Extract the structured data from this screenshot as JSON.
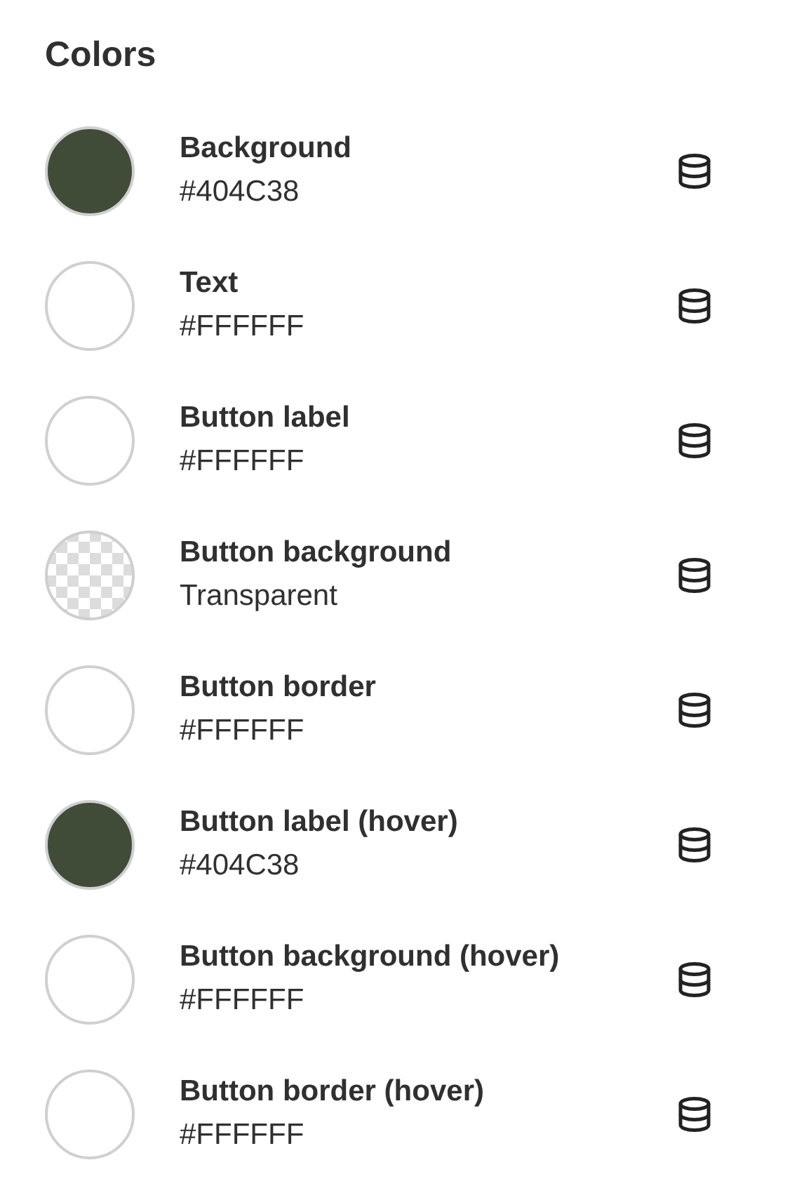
{
  "title": "Colors",
  "colors": [
    {
      "name": "Background",
      "value": "#404C38",
      "kind": "solid",
      "color": "#404c38"
    },
    {
      "name": "Text",
      "value": "#FFFFFF",
      "kind": "solid",
      "color": "#ffffff"
    },
    {
      "name": "Button label",
      "value": "#FFFFFF",
      "kind": "solid",
      "color": "#ffffff"
    },
    {
      "name": "Button background",
      "value": "Transparent",
      "kind": "transparent"
    },
    {
      "name": "Button border",
      "value": "#FFFFFF",
      "kind": "solid",
      "color": "#ffffff"
    },
    {
      "name": "Button label (hover)",
      "value": "#404C38",
      "kind": "solid",
      "color": "#404c38"
    },
    {
      "name": "Button background (hover)",
      "value": "#FFFFFF",
      "kind": "solid",
      "color": "#ffffff"
    },
    {
      "name": "Button border (hover)",
      "value": "#FFFFFF",
      "kind": "solid",
      "color": "#ffffff"
    }
  ]
}
